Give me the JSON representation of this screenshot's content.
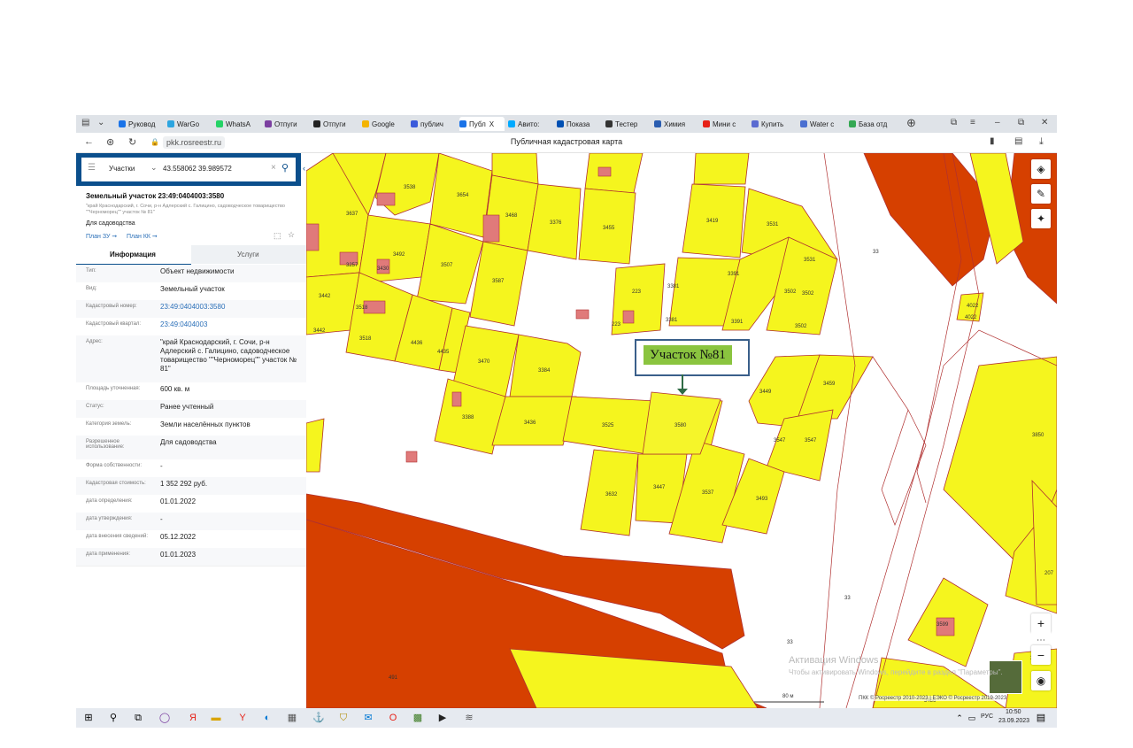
{
  "browser": {
    "tabs": [
      {
        "label": "Руковод",
        "color": "#1a73e8"
      },
      {
        "label": "WarGo",
        "color": "#2ca5e0"
      },
      {
        "label": "WhatsA",
        "color": "#25d366"
      },
      {
        "label": "Отпуги",
        "color": "#7b3fa0"
      },
      {
        "label": "Отпуги",
        "color": "#222222"
      },
      {
        "label": "Google",
        "color": "#f4b400"
      },
      {
        "label": "публич",
        "color": "#3b5bdb"
      },
      {
        "label": "Публ",
        "color": "#1a73e8"
      },
      {
        "label": "Авито:",
        "color": "#00aaff"
      },
      {
        "label": "Показа",
        "color": "#0050b3"
      },
      {
        "label": "Тестер",
        "color": "#333333"
      },
      {
        "label": "Химия",
        "color": "#2a5db0"
      },
      {
        "label": "Мини с",
        "color": "#e62117"
      },
      {
        "label": "Купить",
        "color": "#5b6bd1"
      },
      {
        "label": "Water c",
        "color": "#4a6fd1"
      },
      {
        "label": "База отд",
        "color": "#34a853"
      }
    ],
    "active_tab_close": "X",
    "url": "pkk.rosreestr.ru",
    "page_title": "Публичная кадастровая карта",
    "window_controls": {
      "minimize": "–",
      "restore": "⧉",
      "close": "✕"
    }
  },
  "search": {
    "category": "Участки",
    "value": "43.558062 39.989572"
  },
  "parcel": {
    "title": "Земельный участок 23:49:0404003:3580",
    "address_short": "\"край Краснодарский, г. Сочи, р-н Адлерский с. Галицино, садоводческое товарищество \"\"Черноморец\"\" участок № 81\"",
    "purpose": "Для садоводства",
    "plan_zu": "План ЗУ ➞",
    "plan_kk": "План КК ➞"
  },
  "panel_tabs": {
    "info": "Информация",
    "services": "Услуги"
  },
  "rows": [
    {
      "label": "Тип:",
      "value": "Объект недвижимости",
      "link": false,
      "h": 20
    },
    {
      "label": "Вид:",
      "value": "Земельный участок",
      "link": false,
      "h": 20
    },
    {
      "label": "Кадастровый номер:",
      "value": "23:49:0404003:3580",
      "link": true,
      "h": 20
    },
    {
      "label": "Кадастровый квартал:",
      "value": "23:49:0404003",
      "link": true,
      "h": 20
    },
    {
      "label": "Адрес:",
      "value": "\"край Краснодарский, г. Сочи, р-н Адлерский с. Галицино, садоводческое товарищество \"\"Черноморец\"\" участок № 81\"",
      "link": false,
      "h": 53
    },
    {
      "label": "Площадь уточненная:",
      "value": "600 кв. м",
      "link": false,
      "h": 20
    },
    {
      "label": "Статус:",
      "value": "Ранее учтенный",
      "link": false,
      "h": 20
    },
    {
      "label": "Категория земель:",
      "value": "Земли населённых пунктов",
      "link": false,
      "h": 20
    },
    {
      "label": "Разрешенное использование:",
      "value": "Для садоводства",
      "link": false,
      "h": 27
    },
    {
      "label": "Форма собственности:",
      "value": "-",
      "link": false,
      "h": 20
    },
    {
      "label": "Кадастровая стоимость:",
      "value": "1 352 292 руб.",
      "link": false,
      "h": 20
    },
    {
      "label": "дата определения:",
      "value": "01.01.2022",
      "link": false,
      "h": 20
    },
    {
      "label": "дата утверждения:",
      "value": "-",
      "link": false,
      "h": 20
    },
    {
      "label": "дата внесения сведений:",
      "value": "05.12.2022",
      "link": false,
      "h": 20
    },
    {
      "label": "дата применения:",
      "value": "01.01.2023",
      "link": false,
      "h": 20
    }
  ],
  "map": {
    "callout": "Участок №81",
    "watermark1": "Активация Windows",
    "watermark2": "Чтобы активировать Windows, перейдите в раздел \"Параметры\".",
    "copyright": "ПКК © Росреестр 2010-2023 | ЕЭКО © Росреестр 2019-2023",
    "scale": "80 м",
    "labels": [
      "3538",
      "3654",
      "3637",
      "3468",
      "3376",
      "3455",
      "3419",
      "3531",
      "3531",
      "3492",
      "3507",
      "3587",
      "3391",
      "3381",
      "3381",
      "3391",
      "3502",
      "3502",
      "3502",
      "223",
      "223",
      "3442",
      "3442",
      "3518",
      "3518",
      "4436",
      "4435",
      "3470",
      "3384",
      "3449",
      "3459",
      "3388",
      "3436",
      "3525",
      "3580",
      "3547",
      "3547",
      "3850",
      "3632",
      "3447",
      "3537",
      "3493",
      "3599",
      "4022",
      "4022",
      "491",
      "33",
      "33",
      "33",
      "3605",
      "3456",
      "207",
      "3257",
      "3430"
    ]
  },
  "taskbar": {
    "lang": "РУС",
    "time": "10:50",
    "date": "23.09.2023"
  }
}
